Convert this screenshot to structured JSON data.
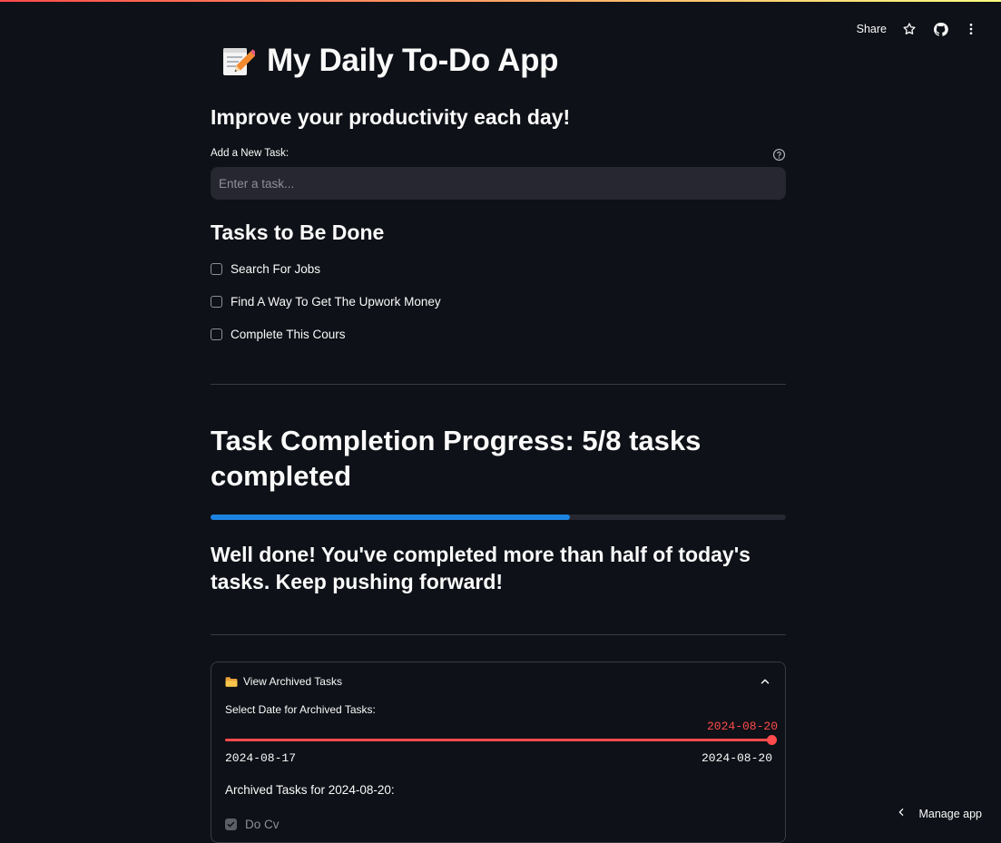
{
  "toolbar": {
    "share_label": "Share",
    "icons": [
      "star-icon",
      "github-icon",
      "more-vertical-icon"
    ]
  },
  "header": {
    "emoji_icon": "memo-pencil-icon",
    "title": "My Daily To-Do App",
    "subtitle": "Improve your productivity each day!"
  },
  "new_task": {
    "label": "Add a New Task:",
    "placeholder": "Enter a task...",
    "value": ""
  },
  "tasks_section": {
    "heading": "Tasks to Be Done",
    "items": [
      {
        "label": "Search For Jobs",
        "checked": false
      },
      {
        "label": "Find A Way To Get The Upwork Money",
        "checked": false
      },
      {
        "label": "Complete This Cours",
        "checked": false
      }
    ]
  },
  "progress": {
    "heading": "Task Completion Progress: 5/8 tasks completed",
    "completed": 5,
    "total": 8,
    "fraction": 0.625,
    "color": "#1c83e1",
    "message": "Well done! You've completed more than half of today's tasks. Keep pushing forward!"
  },
  "archive": {
    "icon": "folder-icon",
    "title": "View Archived Tasks",
    "expanded": true,
    "slider_label": "Select Date for Archived Tasks:",
    "selected_date": "2024-08-20",
    "min_date": "2024-08-17",
    "max_date": "2024-08-20",
    "accent_color": "#ff4b4b",
    "tasks_heading": "Archived Tasks for 2024-08-20:",
    "items": [
      {
        "label": "Do Cv",
        "checked": true
      }
    ]
  },
  "footer": {
    "manage_label": "Manage app"
  }
}
